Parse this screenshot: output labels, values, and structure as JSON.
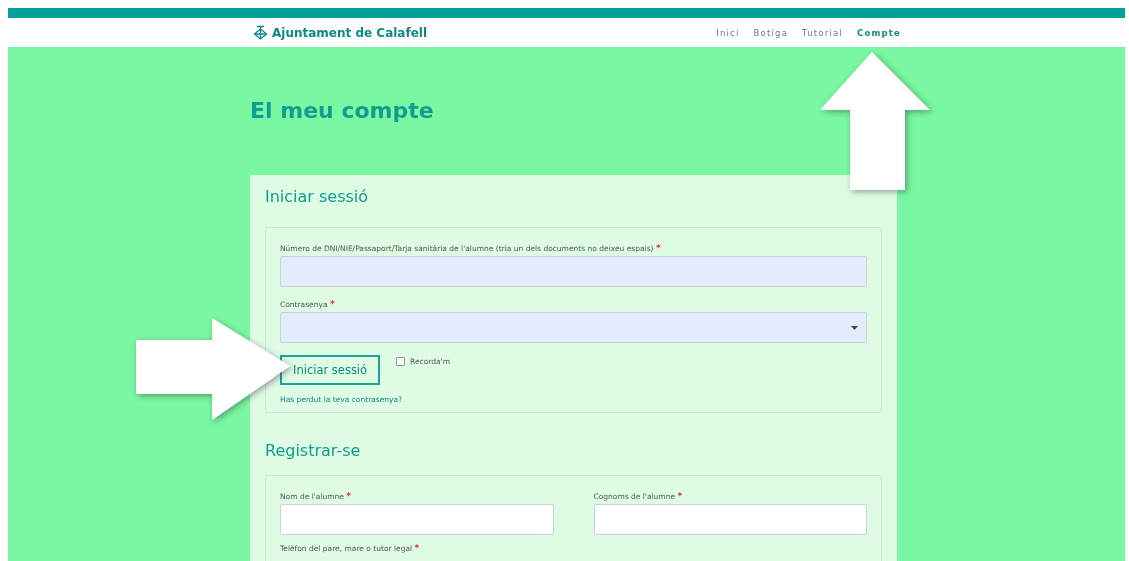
{
  "header": {
    "logo": "Ajuntament de Calafell",
    "nav": [
      {
        "label": "Inici",
        "selected": false
      },
      {
        "label": "Botiga",
        "selected": false
      },
      {
        "label": "Tutorial",
        "selected": false
      },
      {
        "label": "Compte",
        "selected": true
      }
    ]
  },
  "title": "El meu compte",
  "login": {
    "heading": "Iniciar sessió",
    "fields": [
      {
        "kind": "text",
        "label": "Número de DNI/NIE/Passaport/Tarja sanitària de l'alumne (tria un dels documents no deixeu espais)",
        "required_mark": "*"
      },
      {
        "kind": "select",
        "label": "Contrasenya",
        "required_mark": "*"
      }
    ],
    "button": "Iniciar sessió",
    "remember": {
      "label": "Recorda'm",
      "checked": false
    },
    "lost_link": "Has perdut la teva contrasenya?"
  },
  "register": {
    "heading": "Registrar-se",
    "fields": [
      {
        "kind": "text",
        "label": "Nom de l'alumne",
        "required_mark": "*"
      },
      {
        "kind": "text",
        "label": "Cognoms de l'alumne",
        "required_mark": "*"
      },
      {
        "kind": "label",
        "label": "Telèfon del pare, mare o tutor legal",
        "required_mark": "*"
      }
    ]
  }
}
